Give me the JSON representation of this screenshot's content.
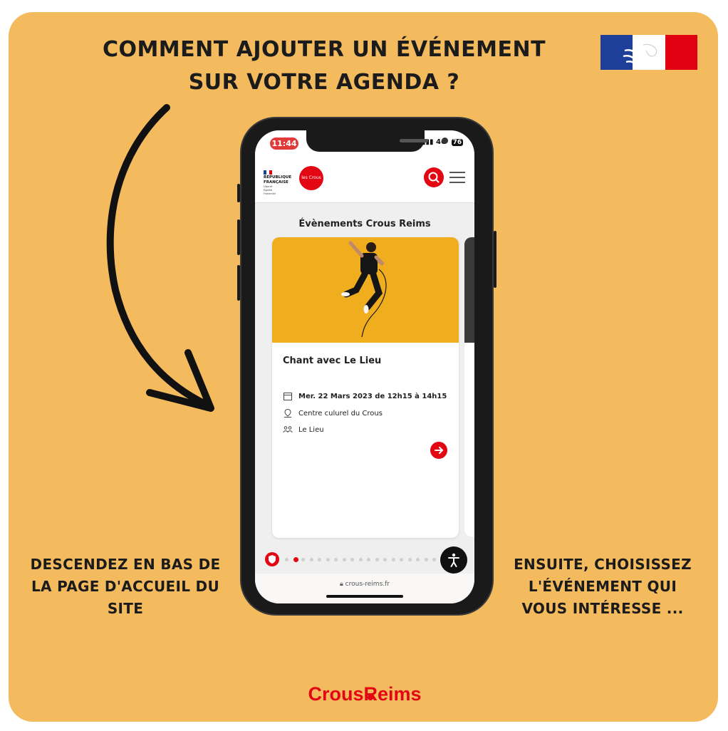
{
  "headline": {
    "line1": "COMMENT AJOUTER UN ÉVÉNEMENT",
    "line2": "SUR VOTRE AGENDA ?"
  },
  "left_instruction": {
    "line1": "DESCENDEZ EN BAS DE",
    "line2": "LA PAGE D'ACCUEIL DU",
    "line3": "SITE"
  },
  "right_instruction": {
    "line1": "ENSUITE, CHOISISSEZ",
    "line2": "L'ÉVÉNEMENT QUI",
    "line3": "VOUS INTÉRESSE ..."
  },
  "brand": {
    "left": "Crous",
    "right": "Reims"
  },
  "phone": {
    "status": {
      "time": "11:44",
      "network": "4G",
      "battery": "76"
    },
    "site_header": {
      "rf_label_1": "RÉPUBLIQUE",
      "rf_label_2": "FRANÇAISE",
      "rf_motto_1": "Liberté",
      "rf_motto_2": "Égalité",
      "rf_motto_3": "Fraternité",
      "logo_text": "les Crous"
    },
    "section_title": "Évènements Crous Reims",
    "event_card": {
      "title": "Chant avec Le Lieu",
      "date": "Mer. 22 Mars 2023 de 12h15 à 14h15",
      "location": "Centre culurel du Crous",
      "organizer": "Le Lieu"
    },
    "carousel": {
      "dot_count": 19,
      "active_index": 1
    },
    "url": "crous-reims.fr"
  },
  "colors": {
    "background": "#f4bb5e",
    "brand_red": "#e30613",
    "flag_blue": "#1d3f9a",
    "flag_red": "#e1000f",
    "card_image_yellow": "#f0ad1e"
  },
  "icons": [
    "marianne-flag-icon",
    "curved-arrow-icon",
    "search-icon",
    "hamburger-menu-icon",
    "calendar-icon",
    "location-pin-icon",
    "people-icon",
    "arrow-right-icon",
    "shield-icon",
    "accessibility-icon",
    "lock-icon"
  ]
}
